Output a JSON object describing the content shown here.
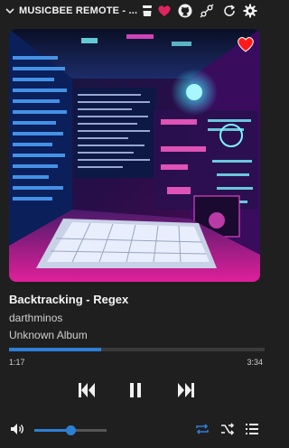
{
  "app": {
    "title": "MUSICBEE REMOTE - ...",
    "titlebar_icons": [
      "chevron-down-icon",
      "cup-icon",
      "heart-icon",
      "github-icon",
      "plug-icon",
      "refresh-icon",
      "gear-icon"
    ]
  },
  "track": {
    "title": "Backtracking - Regex",
    "artist": "darthminos",
    "album": "Unknown Album",
    "favorite": true
  },
  "playback": {
    "current_time": "1:17",
    "duration": "3:34",
    "progress_fraction": 0.36,
    "state": "playing"
  },
  "volume": {
    "level_fraction": 0.5
  },
  "controls": {
    "repeat_active": true,
    "shuffle_active": false
  },
  "colors": {
    "accent": "#2d7fd6",
    "heart": "#e0245e",
    "favorite": "#ff1a1a",
    "background": "#1f1f1f"
  }
}
